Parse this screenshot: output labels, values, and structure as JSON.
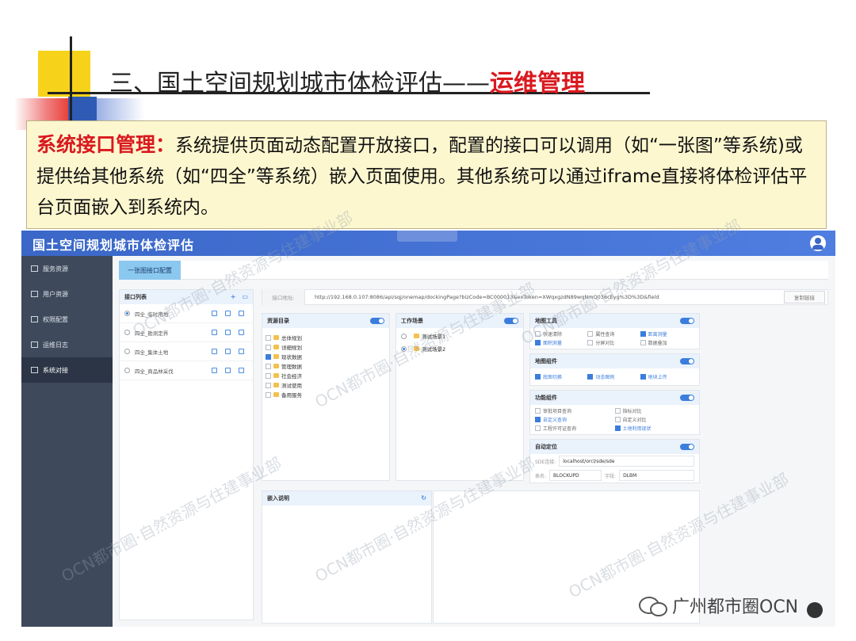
{
  "slide": {
    "title_prefix": "三、国土空间规划城市体检评估——",
    "title_accent": "运维管理",
    "callout_label": "系统接口管理：",
    "callout_text": "系统提供页面动态配置开放接口，配置的接口可以调用（如“一张图”等系统)或提供给其他系统（如“四全”等系统）嵌入页面使用。其他系统可以通过iframe直接将体检评估平台页面嵌入到系统内。"
  },
  "app": {
    "title": "国土空间规划城市体检评估",
    "sidebar": [
      {
        "label": "服务资源",
        "active": false
      },
      {
        "label": "用户资源",
        "active": false
      },
      {
        "label": "权限配置",
        "active": false
      },
      {
        "label": "运维日志",
        "active": false
      },
      {
        "label": "系统对接",
        "active": true
      }
    ],
    "tab": "一张图接口配置",
    "list": {
      "title": "接口列表",
      "items": [
        {
          "label": "四全_临时用地",
          "selected": true
        },
        {
          "label": "四全_勘测定界",
          "selected": false
        },
        {
          "label": "四全_集体土地",
          "selected": false
        },
        {
          "label": "四全_商品林采伐",
          "selected": false
        }
      ]
    },
    "address": {
      "label": "接口地址:",
      "url": "http://192.168.0.107:8086/api/sqj/onemap/dockingPage?bizCode=BC000013&exToken=XWqxgzdN89wqNmQ036cEyg%3D%3D&field",
      "copy_button": "复制链接"
    },
    "resources": {
      "title": "资源目录",
      "items": [
        {
          "label": "总体规划",
          "checked": false
        },
        {
          "label": "详细规划",
          "checked": false
        },
        {
          "label": "现状数据",
          "checked": true
        },
        {
          "label": "管理数据",
          "checked": false
        },
        {
          "label": "社会经济",
          "checked": false
        },
        {
          "label": "测试使用",
          "checked": false
        },
        {
          "label": "备用服务",
          "checked": false
        }
      ]
    },
    "scenes": {
      "title": "工作场景",
      "items": [
        {
          "label": "测试场景1",
          "selected": false
        },
        {
          "label": "测试场景2",
          "selected": true
        }
      ]
    },
    "map_tools": {
      "title": "地图工具",
      "options": [
        {
          "label": "快速清除",
          "checked": false
        },
        {
          "label": "属性查询",
          "checked": false
        },
        {
          "label": "距离测量",
          "checked": true
        },
        {
          "label": "面积测量",
          "checked": true
        },
        {
          "label": "分屏对比",
          "checked": false
        },
        {
          "label": "数据叠加",
          "checked": false
        }
      ]
    },
    "map_widgets": {
      "title": "地图组件",
      "options": [
        {
          "label": "底图切换",
          "checked": true
        },
        {
          "label": "动态图例",
          "checked": true
        },
        {
          "label": "地块上传",
          "checked": true
        }
      ]
    },
    "func_widgets": {
      "title": "功能组件",
      "options": [
        {
          "label": "审批项目查询",
          "checked": false
        },
        {
          "label": "指标对比",
          "checked": false
        },
        {
          "label": "自定义查询",
          "checked": true
        },
        {
          "label": "自定义对比",
          "checked": false
        },
        {
          "label": "工程许可证查询",
          "checked": false
        },
        {
          "label": "土地利用现状",
          "checked": true
        }
      ]
    },
    "auto_locate": {
      "title": "自动定位",
      "sde_label": "SDE连接:",
      "sde_value": "localhost/orcl/sde/sde",
      "table_label": "表名:",
      "table_value": "BLOCKUPD",
      "field_label": "字段:",
      "field_value": "DLBM"
    },
    "embed": {
      "title": "嵌入说明"
    }
  },
  "watermark": "OCN都市圈·自然资源与住建事业部",
  "brand": "广州都市圈OCN"
}
